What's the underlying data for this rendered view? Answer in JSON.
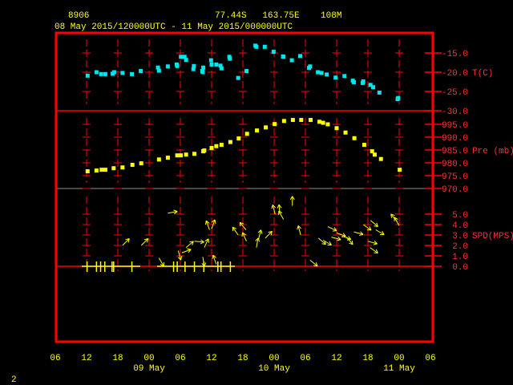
{
  "header": {
    "station": "8906",
    "location": "77.44S   163.75E    108M",
    "period": "08 May 2015/120000UTC - 11 May 2015/000000UTC"
  },
  "page_number": "2",
  "colors": {
    "frame": "#ff0000",
    "text": "#ffff00",
    "temp": "#00e5ee",
    "pressure": "#ffff00",
    "wind": "#ffff00",
    "label": "#ff3030"
  },
  "chart_data": {
    "type": "scatter",
    "x_unit": "hours since 08 May 2015 12 UTC",
    "x_range": [
      -6,
      66
    ],
    "x_tick_labels": [
      "06",
      "12",
      "18",
      "00",
      "06",
      "12",
      "18",
      "00",
      "06",
      "12",
      "18",
      "00",
      "06"
    ],
    "date_labels": [
      {
        "hour": 12,
        "label": "09 May"
      },
      {
        "hour": 36,
        "label": "10 May"
      },
      {
        "hour": 60,
        "label": "11 May"
      }
    ],
    "panels": [
      {
        "name": "temperature",
        "ylabel": "T(C)",
        "ylim": [
          -30,
          -12
        ],
        "ticks": [
          {
            "v": -15,
            "label": "-15.0"
          },
          {
            "v": -20,
            "label": "-20.0"
          },
          {
            "v": -25,
            "label": "-25.0"
          },
          {
            "v": -30,
            "label": "-30.0"
          }
        ],
        "points": [
          [
            0.2,
            -20.9
          ],
          [
            1.9,
            -20.0
          ],
          [
            2.8,
            -20.5
          ],
          [
            3.6,
            -20.5
          ],
          [
            5.0,
            -20.4
          ],
          [
            5.3,
            -20.0
          ],
          [
            6.9,
            -20.2
          ],
          [
            8.7,
            -20.5
          ],
          [
            10.4,
            -19.7
          ],
          [
            13.7,
            -18.8
          ],
          [
            13.9,
            -19.6
          ],
          [
            15.6,
            -18.5
          ],
          [
            17.3,
            -18.0
          ],
          [
            17.4,
            -18.4
          ],
          [
            18.1,
            -16.0
          ],
          [
            18.8,
            -16.0
          ],
          [
            19.1,
            -16.8
          ],
          [
            20.5,
            -19.2
          ],
          [
            20.6,
            -18.4
          ],
          [
            22.2,
            -19.7
          ],
          [
            22.3,
            -20.0
          ],
          [
            22.4,
            -18.8
          ],
          [
            23.9,
            -16.9
          ],
          [
            24.0,
            -18.0
          ],
          [
            24.9,
            -18.0
          ],
          [
            25.7,
            -18.3
          ],
          [
            25.9,
            -19.0
          ],
          [
            27.4,
            -16.0
          ],
          [
            27.5,
            -16.5
          ],
          [
            29.1,
            -21.5
          ],
          [
            30.7,
            -19.7
          ],
          [
            32.4,
            -13.1
          ],
          [
            32.6,
            -13.4
          ],
          [
            34.2,
            -13.4
          ],
          [
            35.9,
            -14.7
          ],
          [
            37.7,
            -15.9
          ],
          [
            37.8,
            -16.0
          ],
          [
            39.4,
            -16.9
          ],
          [
            41.0,
            -15.8
          ],
          [
            42.7,
            -18.9
          ],
          [
            42.9,
            -18.5
          ],
          [
            44.4,
            -20.0
          ],
          [
            45.1,
            -20.2
          ],
          [
            46.1,
            -20.6
          ],
          [
            47.8,
            -21.4
          ],
          [
            49.5,
            -21.0
          ],
          [
            51.1,
            -22.2
          ],
          [
            51.3,
            -22.6
          ],
          [
            53.0,
            -22.8
          ],
          [
            53.1,
            -22.4
          ],
          [
            54.5,
            -23.3
          ],
          [
            55.0,
            -23.9
          ],
          [
            56.2,
            -25.3
          ],
          [
            59.7,
            -27.0
          ],
          [
            59.8,
            -26.7
          ]
        ]
      },
      {
        "name": "pressure",
        "ylabel": "Pre (mb)",
        "ylim": [
          970,
          1000
        ],
        "ticks": [
          {
            "v": 995,
            "label": "995.0"
          },
          {
            "v": 990,
            "label": "990.0"
          },
          {
            "v": 985,
            "label": "985.0"
          },
          {
            "v": 980,
            "label": "980.0"
          },
          {
            "v": 975,
            "label": "975.0"
          },
          {
            "v": 970,
            "label": "970.0"
          }
        ],
        "points": [
          [
            0.2,
            976.7
          ],
          [
            1.9,
            977.0
          ],
          [
            2.9,
            977.3
          ],
          [
            3.6,
            977.3
          ],
          [
            5.2,
            977.9
          ],
          [
            6.9,
            978.2
          ],
          [
            8.8,
            979.2
          ],
          [
            10.5,
            979.8
          ],
          [
            13.9,
            981.3
          ],
          [
            15.6,
            982.0
          ],
          [
            17.4,
            982.9
          ],
          [
            18.1,
            982.9
          ],
          [
            19.1,
            983.2
          ],
          [
            20.7,
            983.5
          ],
          [
            22.4,
            984.5
          ],
          [
            22.6,
            984.8
          ],
          [
            24.0,
            985.8
          ],
          [
            24.9,
            986.5
          ],
          [
            25.9,
            987.0
          ],
          [
            27.6,
            988.1
          ],
          [
            29.2,
            989.5
          ],
          [
            30.8,
            991.3
          ],
          [
            32.7,
            992.6
          ],
          [
            34.4,
            993.8
          ],
          [
            36.1,
            995.1
          ],
          [
            37.9,
            996.3
          ],
          [
            39.6,
            996.7
          ],
          [
            41.2,
            996.7
          ],
          [
            43.0,
            996.7
          ],
          [
            44.7,
            996.0
          ],
          [
            45.4,
            995.6
          ],
          [
            46.3,
            995.0
          ],
          [
            48.0,
            993.5
          ],
          [
            49.7,
            991.8
          ],
          [
            51.4,
            989.6
          ],
          [
            53.3,
            987.0
          ],
          [
            54.8,
            984.5
          ],
          [
            55.3,
            983.2
          ],
          [
            56.5,
            981.5
          ],
          [
            60.1,
            977.3
          ]
        ]
      },
      {
        "name": "wind",
        "ylabel": "SPD(MPS)",
        "ylim": [
          0,
          6
        ],
        "ticks": [
          {
            "v": 5,
            "label": "5.0"
          },
          {
            "v": 4,
            "label": "4.0"
          },
          {
            "v": 3,
            "label": "3.0"
          },
          {
            "v": 2,
            "label": "2.0"
          },
          {
            "v": 1,
            "label": "1.0"
          },
          {
            "v": 0,
            "label": "0.0"
          }
        ],
        "arrows_hour_speed_dir": [
          [
            6.9,
            2.0,
            45
          ],
          [
            10.5,
            2.0,
            45
          ],
          [
            15.6,
            5.1,
            80
          ],
          [
            13.9,
            0.8,
            150
          ],
          [
            17.6,
            1.5,
            165
          ],
          [
            18.3,
            1.3,
            70
          ],
          [
            19.1,
            1.8,
            50
          ],
          [
            20.7,
            2.4,
            95
          ],
          [
            22.3,
            0.9,
            170
          ],
          [
            22.6,
            1.8,
            25
          ],
          [
            24.0,
            3.6,
            20
          ],
          [
            23.6,
            3.5,
            340
          ],
          [
            24.9,
            0.2,
            340
          ],
          [
            29.1,
            3.0,
            325
          ],
          [
            30.6,
            3.5,
            320
          ],
          [
            30.7,
            2.4,
            335
          ],
          [
            32.6,
            1.8,
            10
          ],
          [
            33.0,
            2.6,
            15
          ],
          [
            34.3,
            2.7,
            45
          ],
          [
            36.2,
            5.0,
            345
          ],
          [
            37.1,
            5.0,
            355
          ],
          [
            37.8,
            4.5,
            330
          ],
          [
            39.5,
            5.8,
            0
          ],
          [
            41.1,
            3.0,
            345
          ],
          [
            42.9,
            0.6,
            130
          ],
          [
            44.5,
            2.7,
            130
          ],
          [
            45.4,
            2.5,
            120
          ],
          [
            46.3,
            3.8,
            115
          ],
          [
            47.0,
            2.8,
            105
          ],
          [
            48.0,
            3.2,
            110
          ],
          [
            49.0,
            2.9,
            110
          ],
          [
            49.9,
            2.8,
            140
          ],
          [
            51.3,
            3.3,
            105
          ],
          [
            53.1,
            4.0,
            125
          ],
          [
            54.5,
            4.4,
            130
          ],
          [
            55.5,
            3.5,
            120
          ],
          [
            54.0,
            2.4,
            105
          ],
          [
            54.4,
            1.8,
            125
          ],
          [
            60.0,
            3.9,
            330
          ],
          [
            59.6,
            4.3,
            320
          ]
        ],
        "calm_hours": [
          0.1,
          1.9,
          2.7,
          3.5,
          4.9,
          5.2,
          8.7,
          16.7,
          17.4,
          18.9,
          20.7,
          22.5,
          25.2,
          25.8,
          27.6
        ]
      }
    ]
  }
}
